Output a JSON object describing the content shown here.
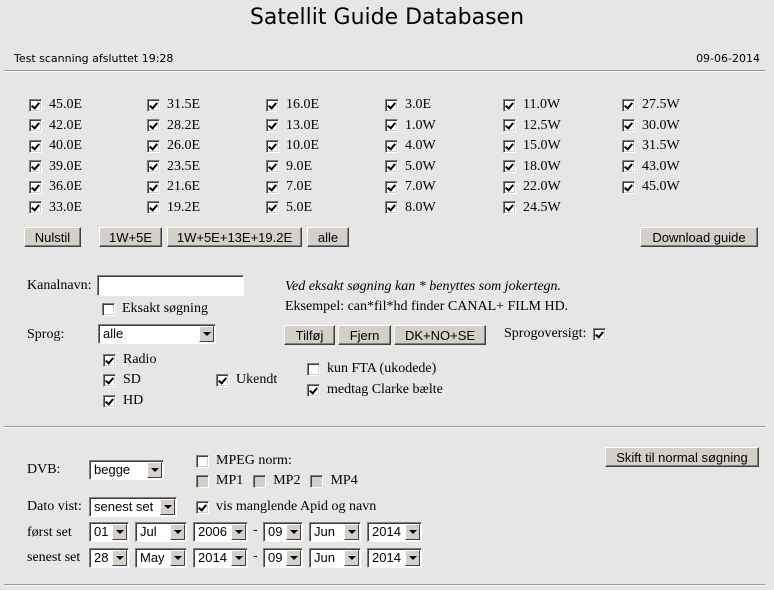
{
  "header": {
    "title": "Satellit Guide Databasen",
    "scan_status": "Test scanning afsluttet 19:28",
    "date": "09-06-2014"
  },
  "satellites": {
    "columns": [
      [
        {
          "label": "45.0E",
          "checked": true
        },
        {
          "label": "42.0E",
          "checked": true
        },
        {
          "label": "40.0E",
          "checked": true
        },
        {
          "label": "39.0E",
          "checked": true
        },
        {
          "label": "36.0E",
          "checked": true
        },
        {
          "label": "33.0E",
          "checked": true
        }
      ],
      [
        {
          "label": "31.5E",
          "checked": true
        },
        {
          "label": "28.2E",
          "checked": true
        },
        {
          "label": "26.0E",
          "checked": true
        },
        {
          "label": "23.5E",
          "checked": true
        },
        {
          "label": "21.6E",
          "checked": true
        },
        {
          "label": "19.2E",
          "checked": true
        }
      ],
      [
        {
          "label": "16.0E",
          "checked": true
        },
        {
          "label": "13.0E",
          "checked": true
        },
        {
          "label": "10.0E",
          "checked": true
        },
        {
          "label": "9.0E",
          "checked": true
        },
        {
          "label": "7.0E",
          "checked": true
        },
        {
          "label": "5.0E",
          "checked": true
        }
      ],
      [
        {
          "label": "3.0E",
          "checked": true
        },
        {
          "label": "1.0W",
          "checked": true
        },
        {
          "label": "4.0W",
          "checked": true
        },
        {
          "label": "5.0W",
          "checked": true
        },
        {
          "label": "7.0W",
          "checked": true
        },
        {
          "label": "8.0W",
          "checked": true
        }
      ],
      [
        {
          "label": "11.0W",
          "checked": true
        },
        {
          "label": "12.5W",
          "checked": true
        },
        {
          "label": "15.0W",
          "checked": true
        },
        {
          "label": "18.0W",
          "checked": true
        },
        {
          "label": "22.0W",
          "checked": true
        },
        {
          "label": "24.5W",
          "checked": true
        }
      ],
      [
        {
          "label": "27.5W",
          "checked": true
        },
        {
          "label": "30.0W",
          "checked": true
        },
        {
          "label": "31.5W",
          "checked": true
        },
        {
          "label": "43.0W",
          "checked": true
        },
        {
          "label": "45.0W",
          "checked": true
        }
      ]
    ],
    "buttons": {
      "reset": "Nulstil",
      "preset1": "1W+5E",
      "preset2": "1W+5E+13E+19.2E",
      "all": "alle",
      "download": "Download guide"
    }
  },
  "search": {
    "channel_label": "Kanalnavn:",
    "channel_value": "",
    "exact_label": "Eksakt søgning",
    "exact_checked": false,
    "hint_line1": "Ved eksakt søgning kan * benyttes som jokertegn.",
    "hint_line2": "Eksempel: can*fil*hd finder CANAL+ FILM HD.",
    "language_label": "Sprog:",
    "language_value": "alle",
    "btn_add": "Tilføj",
    "btn_remove": "Fjern",
    "btn_dknose": "DK+NO+SE",
    "lang_overview_label": "Sprogoversigt:",
    "lang_overview_checked": true,
    "radio_label": "Radio",
    "sd_label": "SD",
    "hd_label": "HD",
    "unknown_label": "Ukendt",
    "fta_label": "kun FTA (ukodede)",
    "fta_checked": false,
    "clarke_label": "medtag Clarke bælte",
    "clarke_checked": true
  },
  "advanced": {
    "dvb_label": "DVB:",
    "dvb_value": "begge",
    "mpeg_label": "MPEG norm:",
    "mp1": "MP1",
    "mp2": "MP2",
    "mp4": "MP4",
    "switch_button": "Skift til normal søgning",
    "date_shown_label": "Dato vist:",
    "date_shown_value": "senest set",
    "missing_label": "vis manglende Apid og navn",
    "first_seen_label": "først set",
    "first_seen": {
      "from_day": "01",
      "from_month": "Jul",
      "from_year": "2006",
      "to_day": "09",
      "to_month": "Jun",
      "to_year": "2014"
    },
    "last_seen_label": "senest set",
    "last_seen": {
      "from_day": "28",
      "from_month": "May",
      "from_year": "2014",
      "to_day": "09",
      "to_month": "Jun",
      "to_year": "2014"
    },
    "dash": "-"
  }
}
